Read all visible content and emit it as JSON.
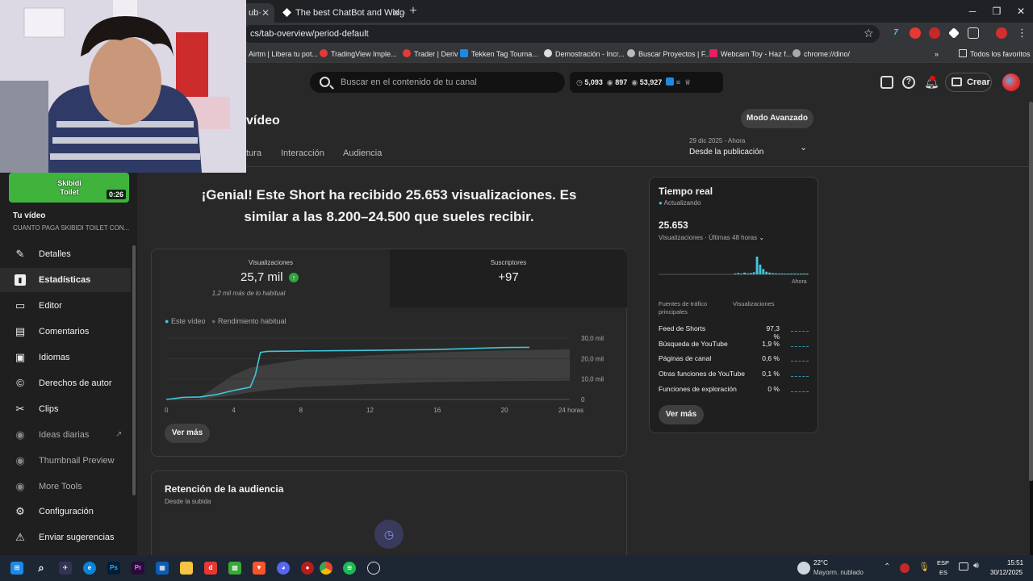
{
  "browser": {
    "tabs": [
      {
        "label": "ub·"
      },
      {
        "label": "The best ChatBot and Widgets"
      }
    ],
    "url": "cs/tab-overview/period-default",
    "bookmarks": [
      "Airtm | Libera tu pot...",
      "TradingView Imple...",
      "Trader | Deriv",
      "Tekken Tag Tourna...",
      "Demostración - Incr...",
      "Buscar Proyectos | F...",
      "Webcam Toy - Haz f...",
      "chrome://dino/"
    ],
    "all_bookmarks": "Todos los favoritos"
  },
  "header": {
    "search_placeholder": "Buscar en el contenido de tu canal",
    "stat1": "5,093",
    "stat2": "897",
    "stat3": "53,927",
    "create_label": "Crear"
  },
  "sidebar": {
    "thumb_text": "Skibidi Toilet",
    "thumb_duration": "0:26",
    "video_label": "Tu vídeo",
    "video_title": "CUANTO PAGA SKIBIDI TOILET CON...",
    "items": [
      {
        "label": "Detalles",
        "icon": "pencil-icon"
      },
      {
        "label": "Estadísticas",
        "icon": "chart-icon"
      },
      {
        "label": "Editor",
        "icon": "film-icon"
      },
      {
        "label": "Comentarios",
        "icon": "comment-icon"
      },
      {
        "label": "Idiomas",
        "icon": "subtitles-icon"
      },
      {
        "label": "Derechos de autor",
        "icon": "copyright-icon"
      },
      {
        "label": "Clips",
        "icon": "scissors-icon"
      },
      {
        "label": "Ideas diarias",
        "icon": "extension-icon"
      },
      {
        "label": "Thumbnail Preview",
        "icon": "extension-icon"
      },
      {
        "label": "More Tools",
        "icon": "extension-icon"
      },
      {
        "label": "Configuración",
        "icon": "gear-icon"
      },
      {
        "label": "Enviar sugerencias",
        "icon": "feedback-icon"
      }
    ]
  },
  "page": {
    "title": "vídeo",
    "tabs": [
      "tura",
      "Interacción",
      "Audiencia"
    ],
    "advanced_mode": "Modo Avanzado",
    "period_dates": "29 dic 2025 - Ahora",
    "period_label": "Desde la publicación",
    "headline": "¡Genial! Este Short ha recibido 25.653 visualizaciones. Es similar a las 8.200–24.500 que sueles recibir."
  },
  "overview": {
    "views_label": "Visualizaciones",
    "views_value": "25,7 mil",
    "views_note": "1,2 mil más de lo habitual",
    "subs_label": "Suscriptores",
    "subs_value": "+97",
    "legend_this": "Este vídeo",
    "legend_typical": "Rendimiento habitual",
    "see_more": "Ver más"
  },
  "realtime": {
    "title": "Tiempo real",
    "status": "Actualizando",
    "value": "25.653",
    "subtitle": "Visualizaciones · Últimas 48 horas",
    "now_label": "Ahora",
    "col1": "Fuentes de tráfico principales",
    "col2": "Visualizaciones",
    "sources": [
      {
        "name": "Feed de Shorts",
        "pct": "97,3 %"
      },
      {
        "name": "Búsqueda de YouTube",
        "pct": "1,9 %"
      },
      {
        "name": "Páginas de canal",
        "pct": "0,6 %"
      },
      {
        "name": "Otras funciones de YouTube",
        "pct": "0,1 %"
      },
      {
        "name": "Funciones de exploración",
        "pct": "0 %"
      }
    ],
    "see_more": "Ver más"
  },
  "retention": {
    "title": "Retención de la audiencia",
    "subtitle": "Desde la subida"
  },
  "taskbar": {
    "temp": "22°C",
    "weather": "Mayorm. nublado",
    "lang1": "ESP",
    "lang2": "ES",
    "time": "15:51",
    "date": "30/12/2025"
  },
  "chart_data": {
    "type": "line",
    "x_ticks": [
      "0",
      "4",
      "8",
      "12",
      "16",
      "20",
      "24 horas"
    ],
    "y_ticks": [
      "30,0 mil",
      "20,0 mil",
      "10,0 mil",
      "0"
    ],
    "xlim": [
      0,
      24
    ],
    "ylim": [
      0,
      30000
    ],
    "series": [
      {
        "name": "Este vídeo",
        "color": "#3ec6dc",
        "x": [
          0,
          1,
          2,
          3,
          3.5,
          4,
          4.5,
          5,
          5.3,
          5.6,
          6,
          8,
          12,
          16,
          18,
          20,
          21.6
        ],
        "y": [
          0,
          1000,
          1200,
          2400,
          3400,
          4400,
          5200,
          6000,
          12000,
          23000,
          23500,
          23700,
          24000,
          24400,
          24900,
          25400,
          25500
        ]
      },
      {
        "name": "Rendimiento habitual",
        "color": "#3f3f3f",
        "x": [
          2,
          4,
          5,
          6,
          8,
          12,
          16,
          20,
          24
        ],
        "upper": [
          1000,
          12000,
          15500,
          17000,
          19500,
          21500,
          23000,
          24000,
          24500
        ],
        "lower": [
          0,
          2000,
          3500,
          4500,
          6000,
          7500,
          8500,
          9000,
          9200
        ]
      }
    ]
  },
  "realtime_bars": [
    0,
    0,
    0,
    0,
    0,
    0,
    0,
    0,
    0,
    0,
    0,
    0,
    0,
    0,
    0,
    0,
    0,
    0,
    0,
    0,
    0,
    0,
    0,
    0,
    0.05,
    0.08,
    0.05,
    0.1,
    0.06,
    0.08,
    0.12,
    1.0,
    0.55,
    0.3,
    0.15,
    0.1,
    0.07,
    0.06,
    0.05,
    0.05,
    0.04,
    0.04,
    0.05,
    0.04,
    0.03,
    0.04,
    0.03,
    0.03
  ],
  "colors": {
    "accent": "#3ec6dc",
    "green_badge": "#2ba640",
    "notification": "#ff0000"
  }
}
